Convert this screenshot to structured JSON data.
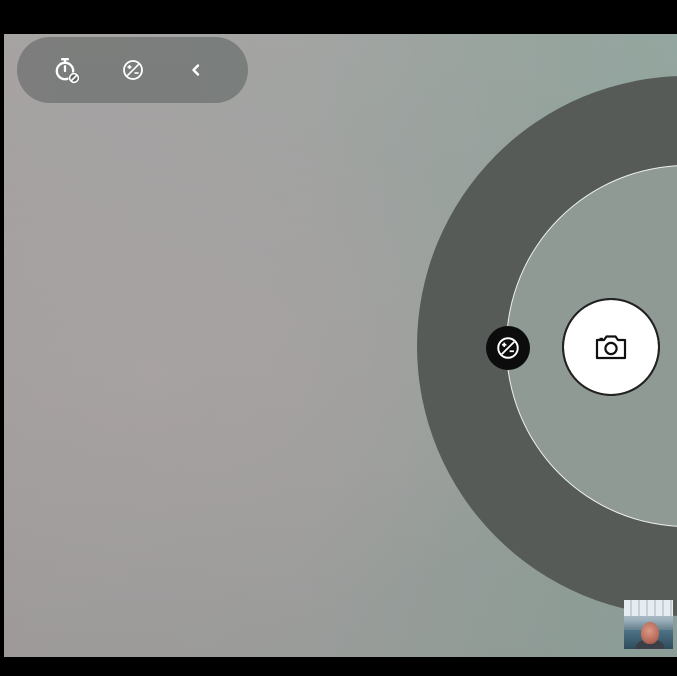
{
  "app": {
    "icons": {
      "timer": "timer-off-icon",
      "exposure": "exposure-icon",
      "collapse": "chevron-left-icon",
      "ring_exposure": "exposure-icon",
      "shutter": "camera-icon",
      "thumbnail": "last-photo-thumbnail"
    },
    "colors": {
      "pill_bg": "#5a5e5c",
      "ring_outer": "#575b58",
      "ring_inner": "#8f9a94",
      "exposure_button": "#0c0c0c",
      "shutter": "#ffffff"
    }
  }
}
